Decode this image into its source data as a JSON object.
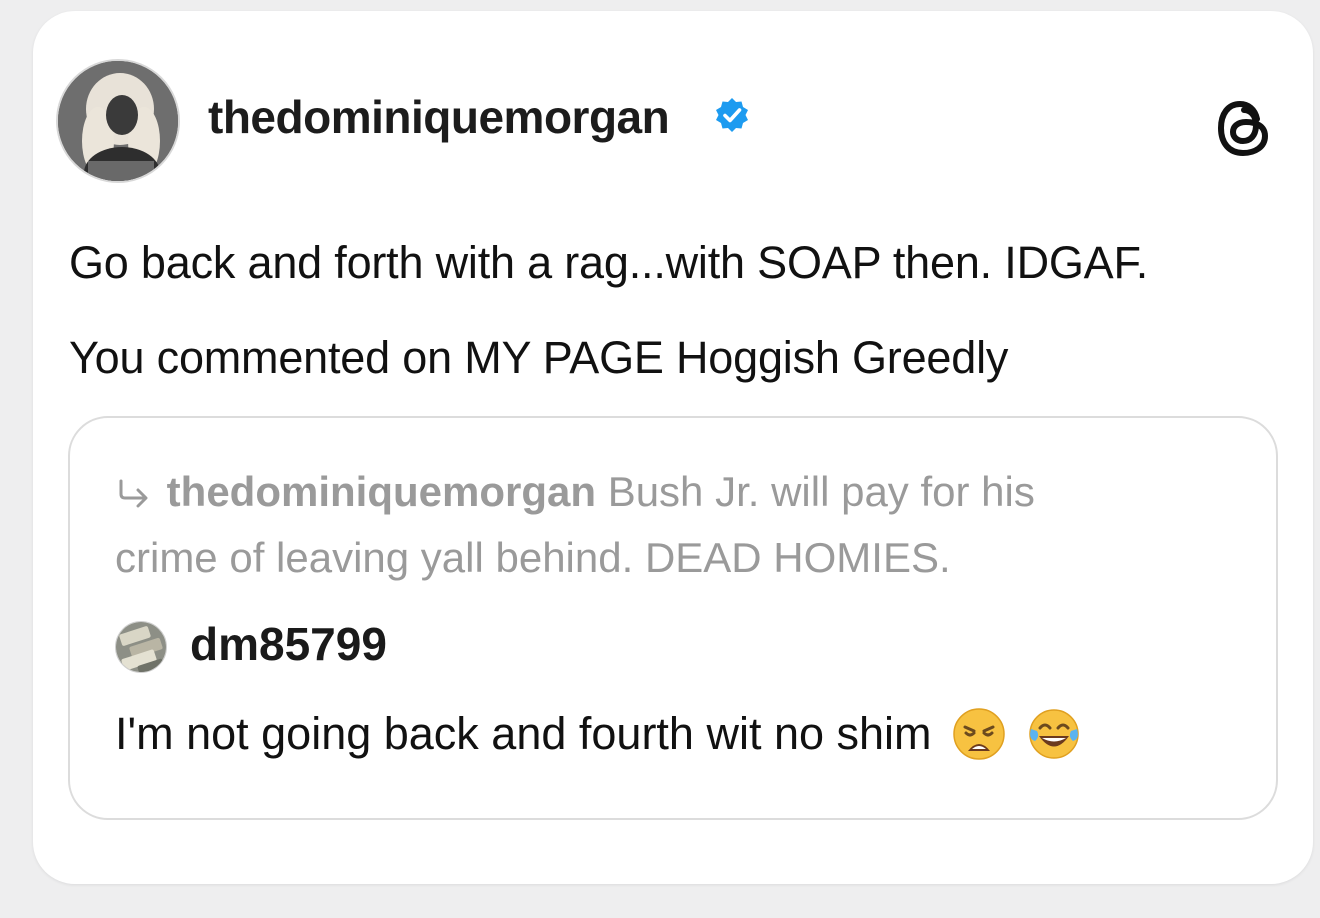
{
  "header": {
    "username": "thedominiquemorgan",
    "verified": true,
    "app_logo": "threads-logo-icon",
    "avatar": "profile-avatar"
  },
  "post": {
    "line1": "Go back and forth with a rag...with SOAP then. IDGAF.",
    "line2": "You commented on MY PAGE Hoggish Greedly"
  },
  "quoted": {
    "reply_to_icon": "reply-arrow-icon",
    "reply_to_user": "thedominiquemorgan",
    "reply_to_text_part1": "Bush Jr. will pay for his",
    "reply_to_text_part2": "crime of leaving yall behind. DEAD HOMIES.",
    "username": "dm85799",
    "text": "I'm not going back and fourth wit no shim",
    "emojis": [
      "weary-face-emoji",
      "tears-of-joy-emoji"
    ]
  },
  "colors": {
    "verified_blue": "#1d9bf0",
    "muted_text": "#9a9a9a",
    "card_border": "#dcdcdc",
    "background": "#eeeeef"
  }
}
